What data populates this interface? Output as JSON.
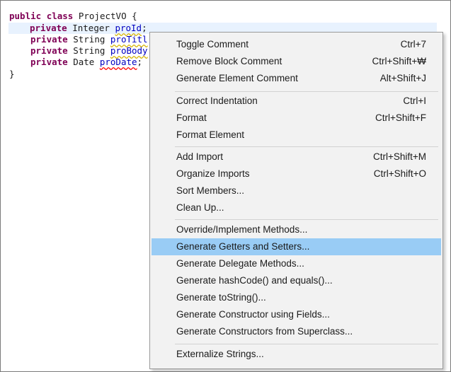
{
  "editor": {
    "line1": {
      "kw1": "public",
      "kw2": "class",
      "name": "ProjectVO {"
    },
    "line2": {
      "kw": "private",
      "type": "Integer",
      "field": "proId",
      "end": ";"
    },
    "line3": {
      "kw": "private",
      "type": "String",
      "field": "proTitl"
    },
    "line4": {
      "kw": "private",
      "type": "String",
      "field": "proBody"
    },
    "line5": {
      "kw": "private",
      "type": "Date",
      "field": "proDate",
      "end": ";"
    },
    "line6": {
      "text": "}"
    }
  },
  "menu": {
    "groups": [
      [
        {
          "label": "Toggle Comment",
          "shortcut": "Ctrl+7"
        },
        {
          "label": "Remove Block Comment",
          "shortcut": "Ctrl+Shift+₩"
        },
        {
          "label": "Generate Element Comment",
          "shortcut": "Alt+Shift+J"
        }
      ],
      [
        {
          "label": "Correct Indentation",
          "shortcut": "Ctrl+I"
        },
        {
          "label": "Format",
          "shortcut": "Ctrl+Shift+F"
        },
        {
          "label": "Format Element",
          "shortcut": ""
        }
      ],
      [
        {
          "label": "Add Import",
          "shortcut": "Ctrl+Shift+M"
        },
        {
          "label": "Organize Imports",
          "shortcut": "Ctrl+Shift+O"
        },
        {
          "label": "Sort Members...",
          "shortcut": ""
        },
        {
          "label": "Clean Up...",
          "shortcut": ""
        }
      ],
      [
        {
          "label": "Override/Implement Methods...",
          "shortcut": ""
        },
        {
          "label": "Generate Getters and Setters...",
          "shortcut": "",
          "highlighted": true
        },
        {
          "label": "Generate Delegate Methods...",
          "shortcut": ""
        },
        {
          "label": "Generate hashCode() and equals()...",
          "shortcut": ""
        },
        {
          "label": "Generate toString()...",
          "shortcut": ""
        },
        {
          "label": "Generate Constructor using Fields...",
          "shortcut": ""
        },
        {
          "label": "Generate Constructors from Superclass...",
          "shortcut": ""
        }
      ],
      [
        {
          "label": "Externalize Strings...",
          "shortcut": ""
        }
      ]
    ]
  },
  "colors": {
    "keyword": "#7f0055",
    "field": "#0000c0",
    "current_line": "#e8f2fe",
    "menu_background": "#f2f2f2",
    "menu_highlight": "#99ccf5"
  }
}
